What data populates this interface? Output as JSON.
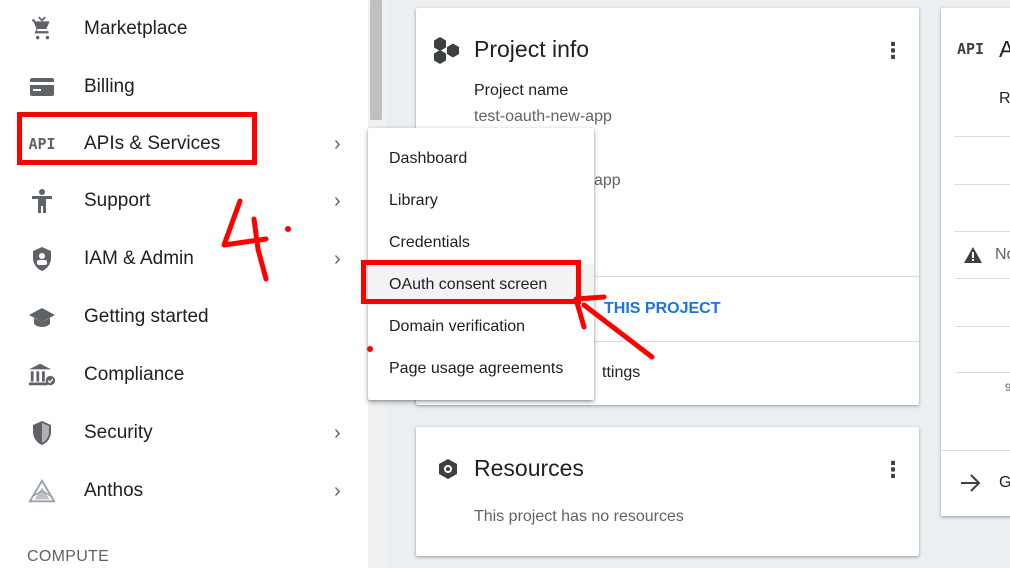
{
  "sidebar": {
    "items": [
      {
        "label": "Marketplace",
        "icon": "cart-icon",
        "chevron": false
      },
      {
        "label": "Billing",
        "icon": "billing-icon",
        "chevron": false
      },
      {
        "label": "APIs & Services",
        "icon": "api-icon",
        "icon_text": "API",
        "chevron": true
      },
      {
        "label": "Support",
        "icon": "support-person-icon",
        "chevron": true
      },
      {
        "label": "IAM & Admin",
        "icon": "shield-lock-icon",
        "chevron": true
      },
      {
        "label": "Getting started",
        "icon": "graduation-cap-icon",
        "chevron": false
      },
      {
        "label": "Compliance",
        "icon": "bank-icon",
        "chevron": false
      },
      {
        "label": "Security",
        "icon": "shield-icon",
        "chevron": true
      },
      {
        "label": "Anthos",
        "icon": "anthos-icon",
        "chevron": true
      }
    ],
    "section_heading": "COMPUTE",
    "chevron_glyph": "›"
  },
  "submenu": {
    "items": [
      "Dashboard",
      "Library",
      "Credentials",
      "OAuth consent screen",
      "Domain verification",
      "Page usage agreements"
    ],
    "highlighted": "OAuth consent screen"
  },
  "project_info_card": {
    "title": "Project info",
    "project_name_label": "Project name",
    "project_name_value": "test-oauth-new-app",
    "partial_value": "app",
    "link_partial": "THIS PROJECT",
    "settings_partial": "ttings",
    "kebab": "⋮"
  },
  "resources_card": {
    "title": "Resources",
    "empty_text": "This project has no resources",
    "kebab": "⋮"
  },
  "api_card": {
    "icon_text": "API",
    "title_partial": "A",
    "row1_partial": "R",
    "warning_partial": "No",
    "small_partial": "9",
    "go_partial": "G"
  },
  "annotation": {
    "step_number": "4.",
    "color": "#ff0000"
  },
  "colors": {
    "accent_link": "#1a73e8",
    "annotation": "#ff0000"
  }
}
